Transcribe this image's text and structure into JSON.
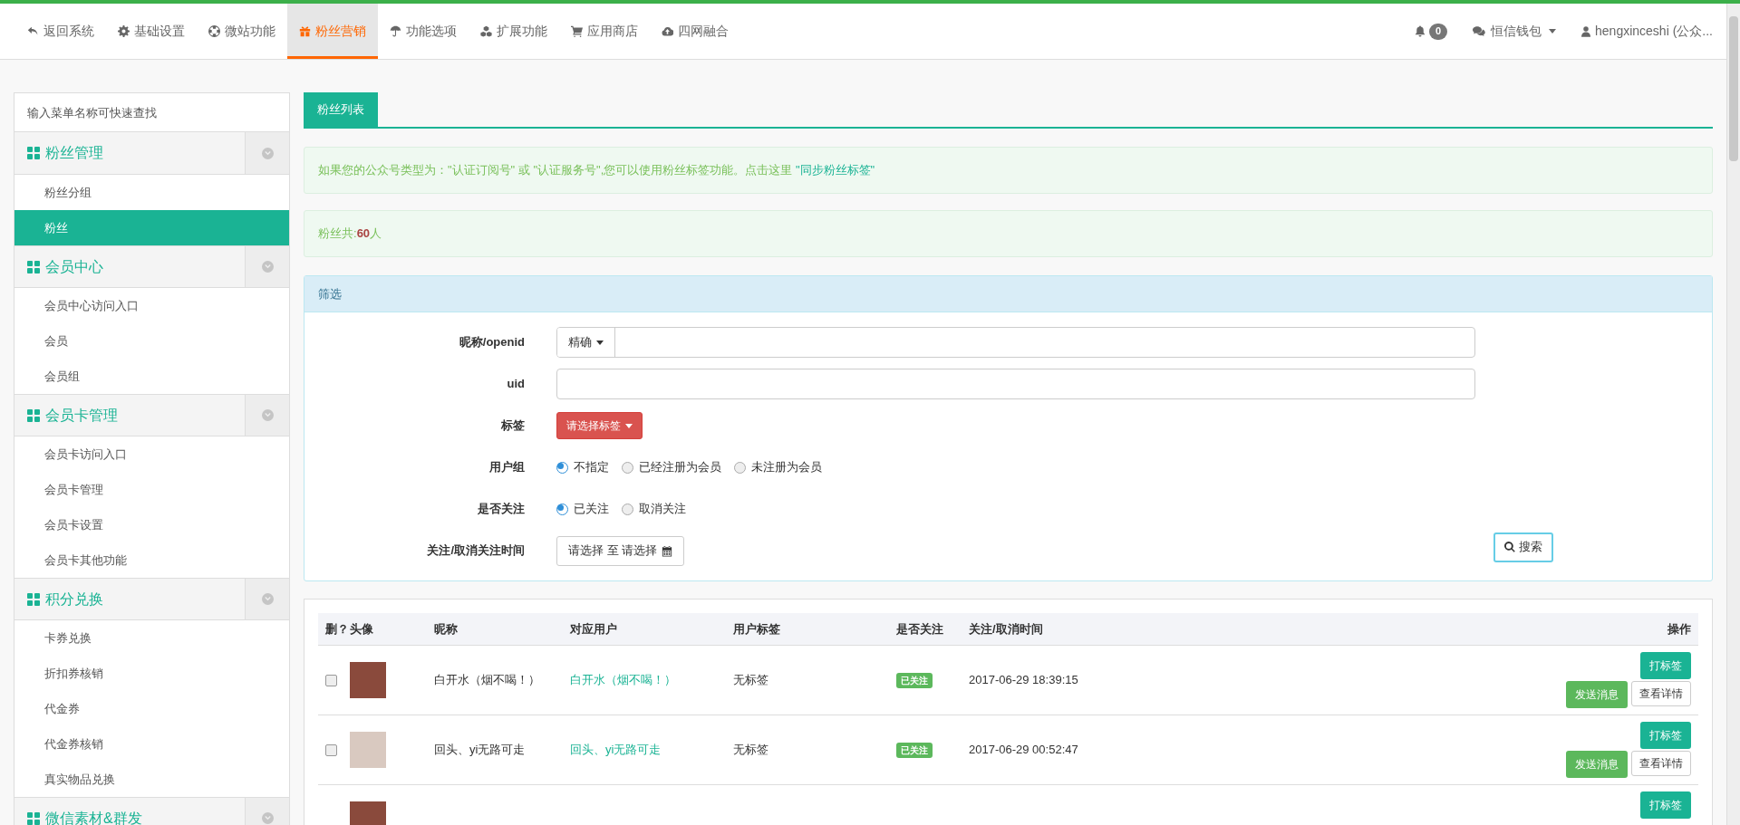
{
  "top_nav": {
    "items": [
      {
        "label": "返回系统",
        "selected": false
      },
      {
        "label": "基础设置",
        "selected": false
      },
      {
        "label": "微站功能",
        "selected": false
      },
      {
        "label": "粉丝营销",
        "selected": true
      },
      {
        "label": "功能选项",
        "selected": false
      },
      {
        "label": "扩展功能",
        "selected": false
      },
      {
        "label": "应用商店",
        "selected": false
      },
      {
        "label": "四网融合",
        "selected": false
      }
    ],
    "notification_count": "0",
    "wallet": "恒信钱包",
    "user": "hengxinceshi (公众..."
  },
  "sidebar": {
    "search_placeholder": "输入菜单名称可快速查找",
    "groups": [
      {
        "title": "粉丝管理",
        "items": [
          {
            "label": "粉丝分组",
            "selected": false
          },
          {
            "label": "粉丝",
            "selected": true
          }
        ]
      },
      {
        "title": "会员中心",
        "items": [
          {
            "label": "会员中心访问入口",
            "selected": false
          },
          {
            "label": "会员",
            "selected": false
          },
          {
            "label": "会员组",
            "selected": false
          }
        ]
      },
      {
        "title": "会员卡管理",
        "items": [
          {
            "label": "会员卡访问入口",
            "selected": false
          },
          {
            "label": "会员卡管理",
            "selected": false
          },
          {
            "label": "会员卡设置",
            "selected": false
          },
          {
            "label": "会员卡其他功能",
            "selected": false
          }
        ]
      },
      {
        "title": "积分兑换",
        "items": [
          {
            "label": "卡券兑换",
            "selected": false
          },
          {
            "label": "折扣券核销",
            "selected": false
          },
          {
            "label": "代金券",
            "selected": false
          },
          {
            "label": "代金券核销",
            "selected": false
          },
          {
            "label": "真实物品兑换",
            "selected": false
          }
        ]
      },
      {
        "title": "微信素材&群发"
      }
    ]
  },
  "tabs": [
    {
      "label": "粉丝列表",
      "selected": true
    }
  ],
  "notice": {
    "text": "如果您的公众号类型为：\"认证订阅号\" 或 \"认证服务号\",您可以使用粉丝标签功能。点击这里",
    "link": "\"同步粉丝标签\""
  },
  "fan_count": "粉丝共:**60**人",
  "filter": {
    "title": "筛选",
    "fields": [
      {
        "kind": "select-input",
        "label": "昵称/openid",
        "select": "精确"
      },
      {
        "kind": "input",
        "label": "uid"
      },
      {
        "kind": "dropdown",
        "label": "标签",
        "button": "请选择标签"
      },
      {
        "kind": "radio",
        "label": "用户组",
        "options": [
          {
            "label": "不指定",
            "selected": true
          },
          {
            "label": "已经注册为会员",
            "selected": false
          },
          {
            "label": "未注册为会员",
            "selected": false
          }
        ]
      },
      {
        "kind": "radio",
        "label": "是否关注",
        "options": [
          {
            "label": "已关注",
            "selected": true
          },
          {
            "label": "取消关注",
            "selected": false
          }
        ]
      },
      {
        "kind": "date-range",
        "label": "关注/取消关注时间",
        "value": "请选择 至 请选择"
      }
    ],
    "search_button": "搜索"
  },
  "table": {
    "columns": [
      "删？",
      "头像",
      "昵称",
      "对应用户",
      "用户标签",
      "是否关注",
      "关注/取消时间",
      "操作"
    ],
    "rows": [
      {
        "checked": false,
        "nickname": "白开水（烟不喝！）",
        "user": "白开水（烟不喝！）",
        "tag": "无标签",
        "status": "已关注",
        "time": "2017-06-29 18:39:15",
        "actions": [
          "打标签",
          "发送消息",
          "查看详情"
        ]
      },
      {
        "checked": false,
        "nickname": "回头、yi无路可走",
        "user": "回头、yi无路可走",
        "tag": "无标签",
        "status": "已关注",
        "time": "2017-06-29 00:52:47",
        "actions": [
          "打标签",
          "发送消息",
          "查看详情"
        ]
      },
      {
        "actions": [
          "打标签"
        ]
      }
    ]
  }
}
